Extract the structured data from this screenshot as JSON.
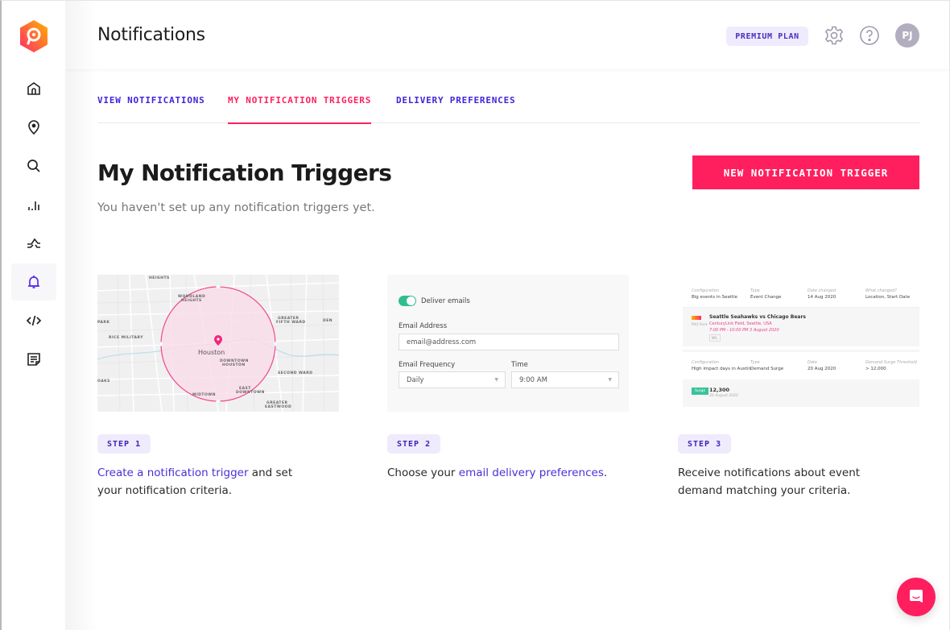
{
  "header": {
    "title": "Notifications",
    "plan_badge": "PREMIUM PLAN",
    "avatar_initials": "PJ"
  },
  "sidebar": {
    "items": [
      {
        "name": "home",
        "active": false
      },
      {
        "name": "locations",
        "active": false
      },
      {
        "name": "search",
        "active": false
      },
      {
        "name": "analytics",
        "active": false
      },
      {
        "name": "trends",
        "active": false
      },
      {
        "name": "notifications",
        "active": true
      },
      {
        "name": "api",
        "active": false
      },
      {
        "name": "docs",
        "active": false
      }
    ]
  },
  "tabs": [
    {
      "label": "VIEW NOTIFICATIONS",
      "active": false
    },
    {
      "label": "MY NOTIFICATION TRIGGERS",
      "active": true
    },
    {
      "label": "DELIVERY PREFERENCES",
      "active": false
    }
  ],
  "main": {
    "heading": "My Notification Triggers",
    "subtitle": "You haven't set up any notification triggers yet.",
    "new_button": "NEW NOTIFICATION TRIGGER"
  },
  "steps": [
    {
      "badge": "STEP 1",
      "link": "Create a notification trigger",
      "text_after": " and set your notification criteria.",
      "illustration": {
        "type": "map",
        "labels": [
          "HEIGHTS",
          "WOODLAND HEIGHTS",
          "GREATER FIFTH WARD",
          "RICE MILITARY",
          "Houston",
          "DOWNTOWN HOUSTON",
          "SECOND WARD",
          "MIDTOWN",
          "EAST DOWNTOWN",
          "GREATER EASTWOOD",
          "DENVER HARBOR",
          "PARK",
          "OAKS"
        ]
      }
    },
    {
      "badge": "STEP 2",
      "text_before": "Choose your ",
      "link": "email delivery preferences",
      "text_after": ".",
      "illustration": {
        "toggle_label": "Deliver emails",
        "email_label": "Email Address",
        "email_placeholder": "email@address.com",
        "frequency_label": "Email Frequency",
        "frequency_value": "Daily",
        "time_label": "Time",
        "time_value": "9:00 AM"
      }
    },
    {
      "badge": "STEP 3",
      "text": "Receive notifications about event demand matching your criteria.",
      "illustration": {
        "card1": {
          "labels": [
            "Configuration",
            "Type",
            "Date changed",
            "What changed?"
          ],
          "values": [
            "Big events in Seattle",
            "Event Change",
            "14 Aug 2020",
            "Location, Start Date"
          ],
          "event_title": "Seattle Seahawks vs Chicago Bears",
          "event_venue": "CenturyLink Field, Seattle, USA",
          "event_time": "7:00 PM - 10:00 PM 3 August 2020",
          "event_tag": "NFL",
          "rank_label": "PHQ Rank"
        },
        "card2": {
          "labels": [
            "Configuration",
            "Type",
            "Date",
            "Demand Surge Threshold"
          ],
          "values": [
            "High impact days in Austin",
            "Demand Surge",
            "20 Aug 2020",
            "> 12,000"
          ],
          "surge_tag": "Surge",
          "surge_value": "12,300",
          "surge_date": "20 August 2020"
        }
      }
    }
  ],
  "colors": {
    "accent": "#ff1f5e",
    "link": "#3f25d8",
    "badge_bg": "#efebfd"
  }
}
